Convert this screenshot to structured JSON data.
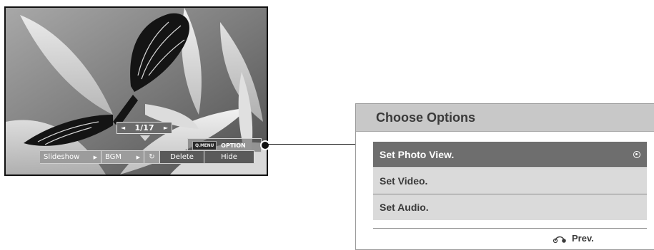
{
  "photo_viewer": {
    "counter": "1/17",
    "options_hint": {
      "key": "Q.MENU",
      "label": "OPTION"
    },
    "controls": {
      "slideshow": "Slideshow",
      "bgm": "BGM",
      "delete": "Delete",
      "hide": "Hide"
    },
    "icons": [
      "arrow-left-icon",
      "arrow-right-icon",
      "rotate-icon"
    ]
  },
  "options_menu": {
    "title": "Choose Options",
    "items": [
      {
        "label": "Set Photo View.",
        "selected": true
      },
      {
        "label": "Set Video.",
        "selected": false
      },
      {
        "label": "Set Audio.",
        "selected": false
      }
    ],
    "footer": {
      "prev_label": "Prev.",
      "icon": "return-icon"
    }
  },
  "colors": {
    "menu_header_bg": "#c8c8c8",
    "item_bg": "#dadada",
    "item_selected_bg": "#6e6e6e"
  }
}
